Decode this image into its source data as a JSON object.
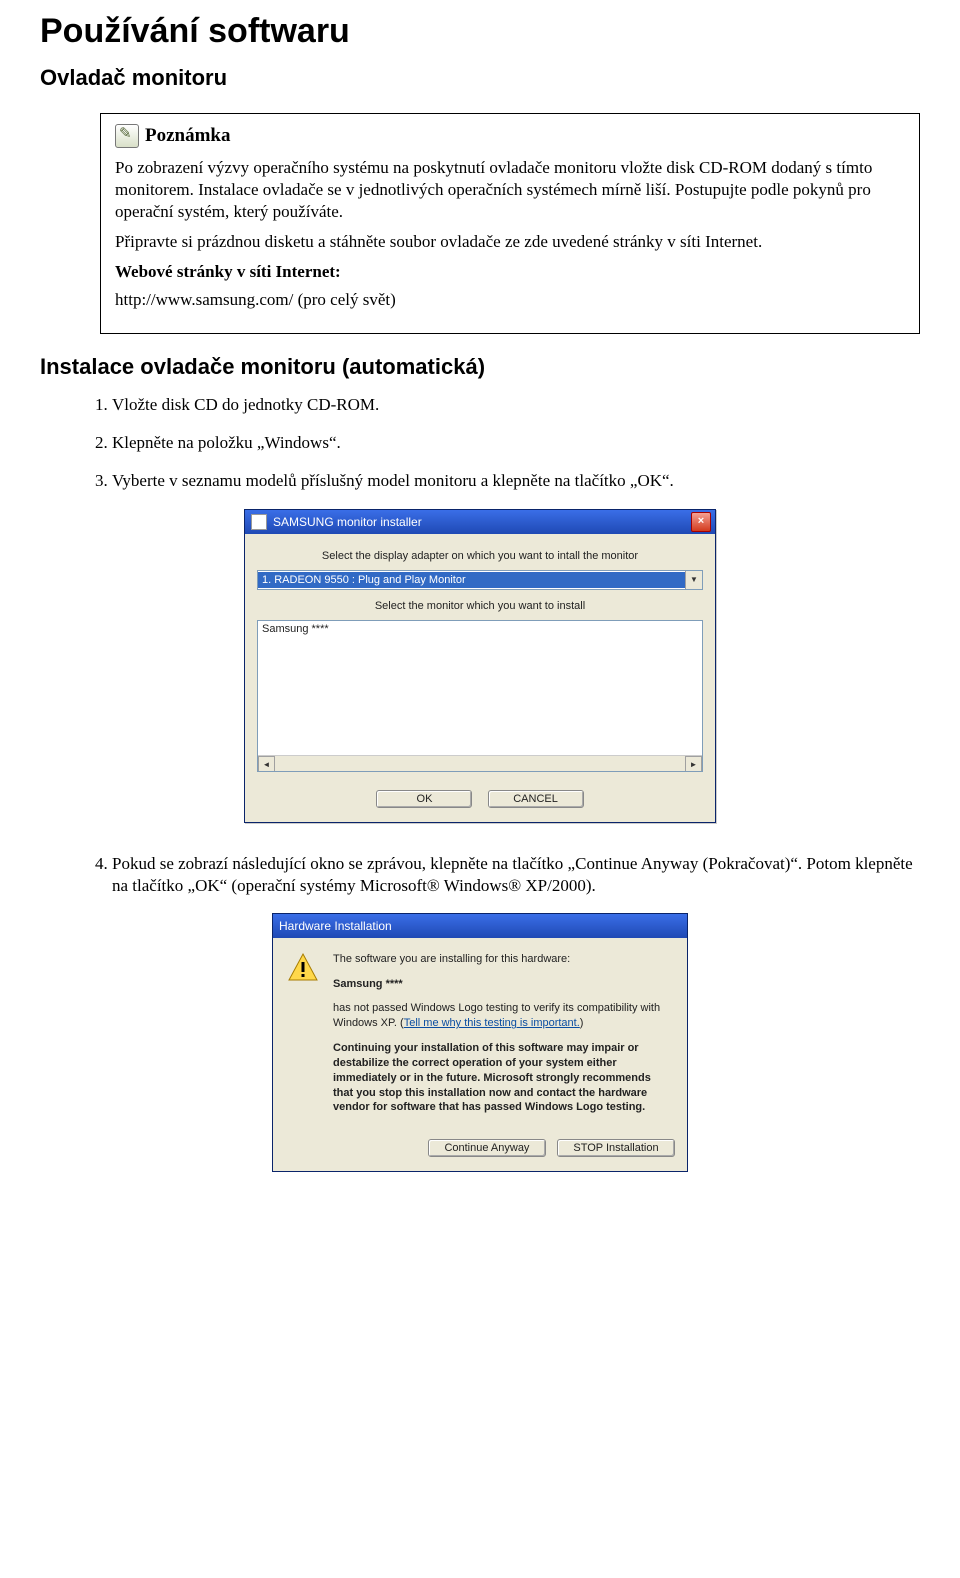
{
  "title": "Používání softwaru",
  "section": "Ovladač monitoru",
  "note": {
    "label": "Poznámka",
    "p1": "Po zobrazení výzvy operačního systému na poskytnutí ovladače monitoru vložte disk CD-ROM dodaný s tímto monitorem. Instalace ovladače se v jednotlivých operačních systémech mírně liší. Postupujte podle pokynů pro operační systém, který používáte.",
    "p2": "Připravte si prázdnou disketu a stáhněte soubor ovladače ze zde uvedené stránky v síti Internet.",
    "bold_line": "Webové stránky v síti Internet:",
    "url_line": "http://www.samsung.com/ (pro celý svět)"
  },
  "install_heading": "Instalace ovladače monitoru (automatická)",
  "steps": {
    "1": "Vložte disk CD do jednotky CD-ROM.",
    "2": "Klepněte na položku „Windows“.",
    "3": "Vyberte v seznamu modelů příslušný model monitoru a klepněte na tlačítko „OK“.",
    "4": "Pokud se zobrazí následující okno se zprávou, klepněte na tlačítko „Continue Anyway (Pokračovat)“. Potom klepněte na tlačítko „OK“ (operační systémy Microsoft® Windows® XP/2000)."
  },
  "installer": {
    "title": "SAMSUNG monitor installer",
    "line1": "Select the display adapter on which you want to intall the monitor",
    "combo_value": "1. RADEON 9550 : Plug and Play Monitor",
    "line2": "Select the monitor which you want to install",
    "list_item": "Samsung ****",
    "ok": "OK",
    "cancel": "CANCEL"
  },
  "hw": {
    "title": "Hardware Installation",
    "l1": "The software you are installing for this hardware:",
    "model": "Samsung ****",
    "l2a": "has not passed Windows Logo testing to verify its compatibility with Windows XP. (",
    "link": "Tell me why this testing is important.",
    "l2b": ")",
    "warn": "Continuing your installation of this software may impair or destabilize the correct operation of your system either immediately or in the future. Microsoft strongly recommends that you stop this installation now and contact the hardware vendor for software that has passed Windows Logo testing.",
    "btn_continue": "Continue Anyway",
    "btn_stop": "STOP Installation"
  }
}
